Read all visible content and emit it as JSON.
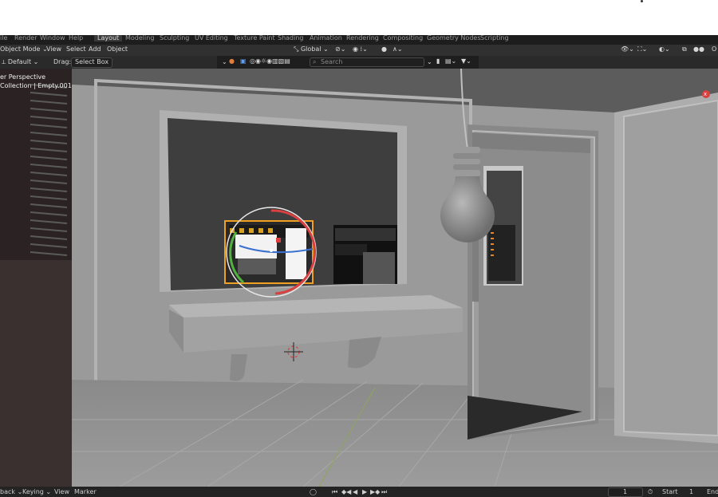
{
  "tabs": [
    "Layout",
    "Modeling",
    "Sculpting",
    "UV Editing",
    "Texture Paint",
    "Shading",
    "Animation",
    "Rendering",
    "Compositing",
    "Geometry Nodes",
    "Scripting"
  ],
  "header": {
    "mode": "Object Mode",
    "menus": [
      "View",
      "Select",
      "Add",
      "Object"
    ],
    "transform_orientation": "Global",
    "options_label": "O"
  },
  "tool_settings": {
    "orientation": "Default",
    "drag_label": "Drag:",
    "drag_value": "Select Box",
    "search_placeholder": "Search"
  },
  "viewport": {
    "view_name": "er Perspective",
    "collection_info": "Collection | Empty.001"
  },
  "timeline": {
    "playback": "back",
    "keying": "Keying",
    "view": "View",
    "marker": "Marker",
    "current_frame": "1",
    "start_label": "Start",
    "start_value": "1",
    "end_label": "End"
  },
  "colors": {
    "viewport_bg": "#7b7b7b",
    "wall": "#9a9a9a",
    "selected_outline": "#f0a020",
    "gizmo_red": "#d94040",
    "gizmo_green": "#50b040",
    "gizmo_blue": "#3a70d0"
  }
}
